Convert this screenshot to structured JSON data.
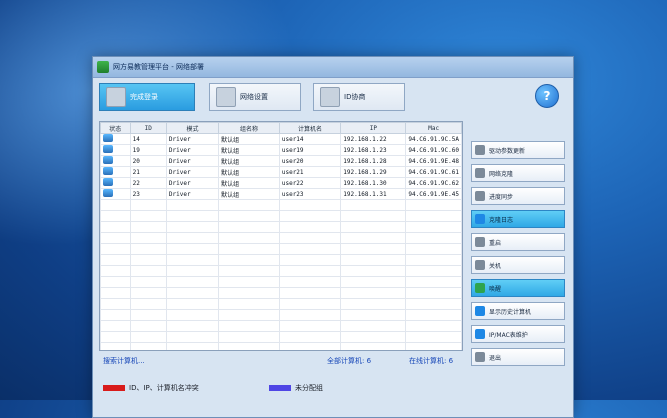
{
  "window": {
    "title": "网方易教管理平台 - 网络部署"
  },
  "toolbar": {
    "buttons": [
      {
        "label": "完成登录"
      },
      {
        "label": "网络设置"
      },
      {
        "label": "ID协商"
      }
    ],
    "help_label": "?"
  },
  "table": {
    "headers": [
      "状态",
      "ID",
      "模式",
      "组名称",
      "计算机名",
      "IP",
      "Mac"
    ],
    "rows": [
      {
        "id": "14",
        "mode": "Driver",
        "group": "默认组",
        "name": "user14",
        "ip": "192.168.1.22",
        "mac": "94.C6.91.9C.5A"
      },
      {
        "id": "19",
        "mode": "Driver",
        "group": "默认组",
        "name": "user19",
        "ip": "192.168.1.23",
        "mac": "94.C6.91.9C.60"
      },
      {
        "id": "20",
        "mode": "Driver",
        "group": "默认组",
        "name": "user20",
        "ip": "192.168.1.28",
        "mac": "94.C6.91.9E.48"
      },
      {
        "id": "21",
        "mode": "Driver",
        "group": "默认组",
        "name": "user21",
        "ip": "192.168.1.29",
        "mac": "94.C6.91.9C.61"
      },
      {
        "id": "22",
        "mode": "Driver",
        "group": "默认组",
        "name": "user22",
        "ip": "192.168.1.30",
        "mac": "94.C6.91.9C.62"
      },
      {
        "id": "23",
        "mode": "Driver",
        "group": "默认组",
        "name": "user23",
        "ip": "192.168.1.31",
        "mac": "94.C6.91.9E.45"
      }
    ]
  },
  "side": {
    "buttons": [
      {
        "label": "驱动参数更新"
      },
      {
        "label": "网络克隆"
      },
      {
        "label": "进度同步"
      },
      {
        "label": "克隆日志"
      },
      {
        "label": "重启"
      },
      {
        "label": "关机"
      },
      {
        "label": "唤醒"
      },
      {
        "label": "显示历史计算机"
      },
      {
        "label": "IP/MAC表维护"
      },
      {
        "label": "退出"
      }
    ]
  },
  "status": {
    "search": "搜索计算机...",
    "all_computers": "全部计算机: 6",
    "online_computers": "在线计算机: 6"
  },
  "legend": {
    "conflict": "ID、IP、计算机名冲突",
    "unassigned": "未分配组"
  },
  "colors": {
    "conflict": "#d81b1b",
    "unassigned": "#4f46e5"
  }
}
